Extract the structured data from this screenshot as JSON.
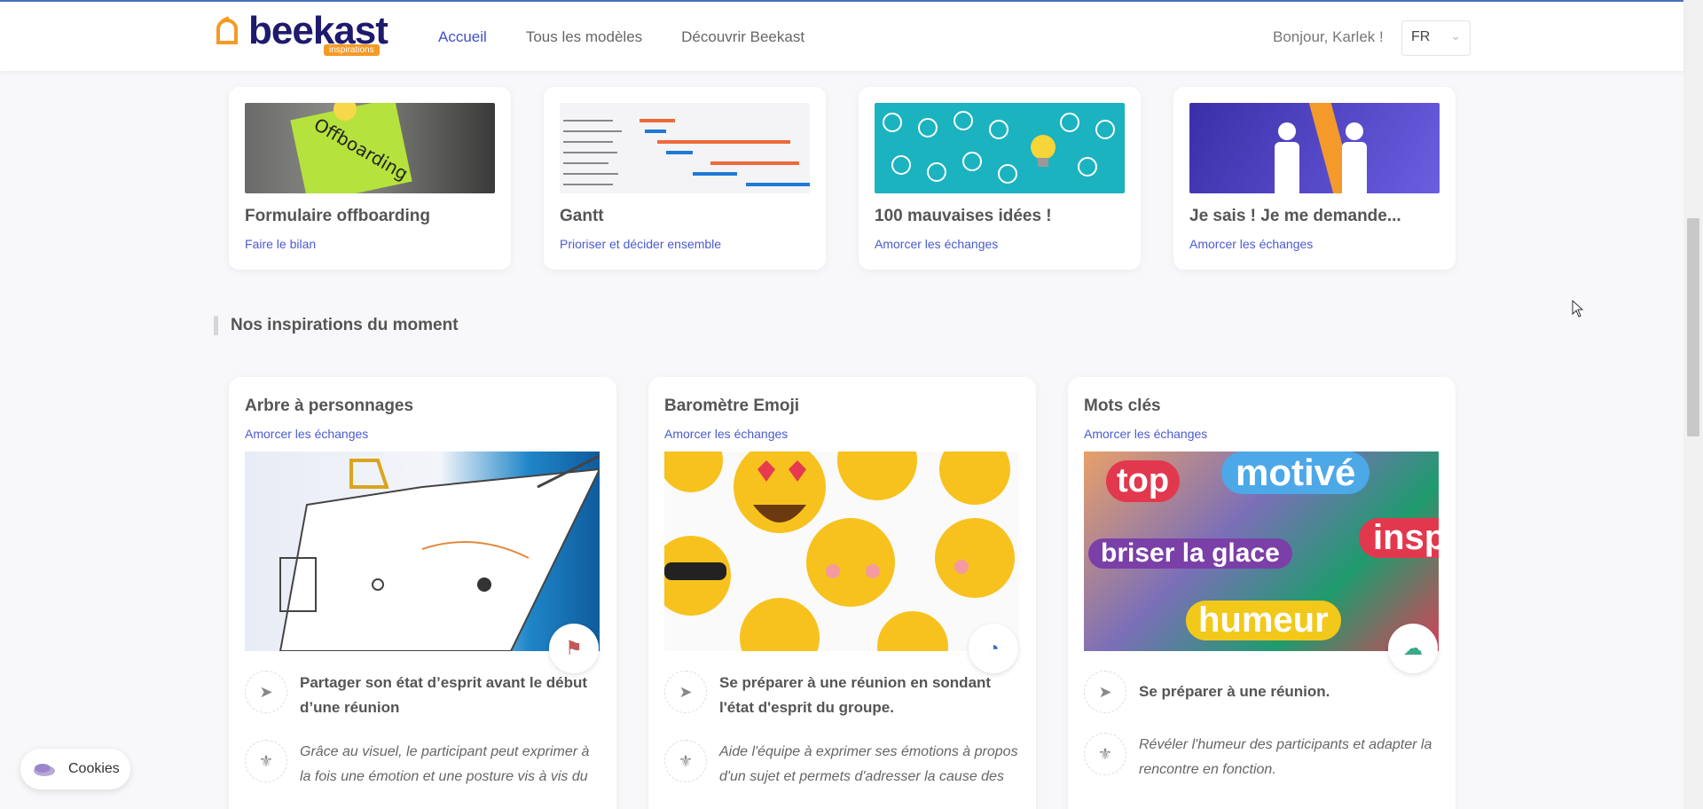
{
  "header": {
    "brand": "beekast",
    "brand_tag": "inspirations",
    "nav": [
      "Accueil",
      "Tous les modèles",
      "Découvrir Beekast"
    ],
    "greeting": "Bonjour, Karlek !",
    "language": "FR"
  },
  "top_cards": [
    {
      "title": "Formulaire offboarding",
      "subtitle": "Faire le bilan"
    },
    {
      "title": "Gantt",
      "subtitle": "Prioriser et décider ensemble"
    },
    {
      "title": "100 mauvaises idées !",
      "subtitle": "Amorcer les échanges"
    },
    {
      "title": "Je sais ! Je me demande...",
      "subtitle": "Amorcer les échanges"
    }
  ],
  "section_title": "Nos inspirations du moment",
  "insp_cards": [
    {
      "title": "Arbre à personnages",
      "subtitle": "Amorcer les échanges",
      "goal": "Partager son état d’esprit avant le début d’une réunion",
      "desc": "Grâce au visuel, le participant peut exprimer à la fois une émotion et une posture vis à vis du"
    },
    {
      "title": "Baromètre Emoji",
      "subtitle": "Amorcer les échanges",
      "goal": "Se préparer à une réunion en sondant l'état d'esprit du groupe.",
      "desc": "Aide l'équipe à exprimer ses émotions à propos d'un sujet et permets d'adresser la cause des"
    },
    {
      "title": "Mots clés",
      "subtitle": "Amorcer les échanges",
      "goal": "Se préparer à une réunion.",
      "desc": "Révéler l'humeur des participants et adapter la rencontre en fonction."
    }
  ],
  "word_cloud": [
    "top",
    "motivé",
    "briser la glace",
    "insp",
    "humeur"
  ],
  "offboarding_note": "Offboarding",
  "cookies": "Cookies",
  "colors": {
    "accent": "#3f51c8",
    "brand": "#1e1a6e",
    "brand_orange": "#f59a25"
  }
}
